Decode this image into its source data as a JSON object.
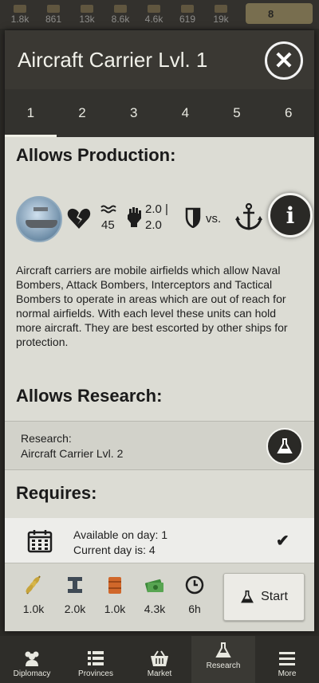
{
  "resources": [
    {
      "icon": "grain-icon",
      "value": "1.8k"
    },
    {
      "icon": "crate-icon",
      "value": "861"
    },
    {
      "icon": "box-icon",
      "value": "13k"
    },
    {
      "icon": "steel-icon",
      "value": "8.6k"
    },
    {
      "icon": "oil-icon",
      "value": "4.6k"
    },
    {
      "icon": "component-icon",
      "value": "619"
    },
    {
      "icon": "money-icon",
      "value": "19k"
    }
  ],
  "gold": {
    "value": "8"
  },
  "dialog": {
    "title": "Aircraft Carrier Lvl. 1",
    "tabs": [
      "1",
      "2",
      "3",
      "4",
      "5",
      "6"
    ],
    "active_tab": "1"
  },
  "allows_production": {
    "title": "Allows Production:",
    "unit_image": "aircraft-carrier-unit",
    "stats": {
      "hitpoints_icon": "broken-heart-icon",
      "speed_icon": "waves-icon",
      "speed": "45",
      "attack_icon": "fist-icon",
      "attack": "2.0 |",
      "attack2": "2.0",
      "defense_icon": "shield-icon",
      "vs": "vs.",
      "versus_icon": "anchor-icon"
    },
    "description": "Aircraft carriers are mobile airfields which allow Naval Bombers, Attack Bombers, Interceptors and Tactical Bombers to operate in areas which are out of reach for normal airfields. With each level these units can hold more aircraft. They are best escorted by other ships for protection."
  },
  "allows_research": {
    "title": "Allows Research:",
    "label": "Research:",
    "value": "Aircraft Carrier Lvl. 2"
  },
  "requires": {
    "title": "Requires:",
    "available": "Available on day: 1",
    "current": "Current day is: 4"
  },
  "costs": [
    {
      "icon": "grain-icon",
      "value": "1.0k",
      "color": "#c7a43a"
    },
    {
      "icon": "steel-icon",
      "value": "2.0k",
      "color": "#3f4a55"
    },
    {
      "icon": "oil-icon",
      "value": "1.0k",
      "color": "#d0672a"
    },
    {
      "icon": "money-icon",
      "value": "4.3k",
      "color": "#3d8a3a"
    },
    {
      "icon": "clock-icon",
      "value": "6h",
      "color": "#1e1e1e"
    }
  ],
  "start_label": "Start",
  "nav": [
    {
      "label": "Diplomacy",
      "icon": "people-icon"
    },
    {
      "label": "Provinces",
      "icon": "list-icon"
    },
    {
      "label": "Market",
      "icon": "basket-icon"
    },
    {
      "label": "Research",
      "icon": "flask-icon"
    },
    {
      "label": "More",
      "icon": "menu-icon"
    }
  ]
}
